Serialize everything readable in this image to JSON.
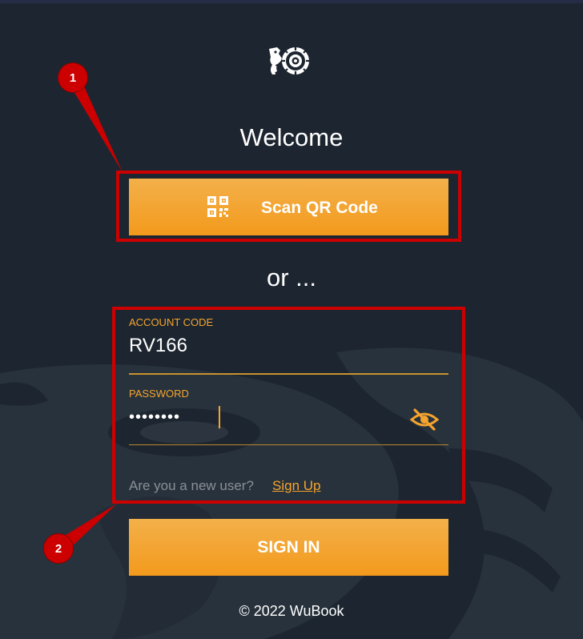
{
  "header": {
    "logo_icon": "wubook-logo-icon",
    "title": "Welcome"
  },
  "qr_button": {
    "label": "Scan QR Code",
    "icon": "qr-code-icon"
  },
  "separator": "or ...",
  "form": {
    "account_code": {
      "label": "ACCOUNT CODE",
      "value": "RV166"
    },
    "password": {
      "label": "PASSWORD",
      "value": "••••••••",
      "toggle_icon": "eye-slash-icon"
    },
    "new_user_text": "Are you a new user?",
    "signup_label": "Sign Up"
  },
  "signin_button": {
    "label": "SIGN IN"
  },
  "footer": {
    "copyright": "© 2022 WuBook"
  },
  "annotations": {
    "marker_1": "1",
    "marker_2": "2"
  },
  "colors": {
    "background": "#1d2630",
    "accent": "#f5a42e",
    "button": "#f3a12a",
    "annotation": "#cc0000"
  }
}
